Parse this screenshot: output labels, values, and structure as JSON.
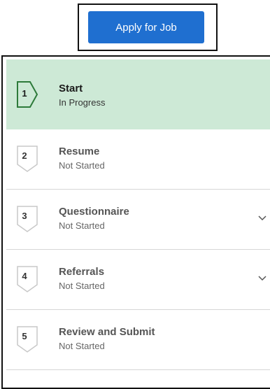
{
  "apply_button": {
    "label": "Apply for Job"
  },
  "colors": {
    "accent": "#1f6fd0",
    "active_step_bg": "#cde9d6",
    "active_step_marker": "#2d7a3a",
    "inactive_marker": "#c8c8c8"
  },
  "steps": [
    {
      "number": "1",
      "title": "Start",
      "status": "In Progress",
      "active": true,
      "expandable": false
    },
    {
      "number": "2",
      "title": "Resume",
      "status": "Not Started",
      "active": false,
      "expandable": false
    },
    {
      "number": "3",
      "title": "Questionnaire",
      "status": "Not Started",
      "active": false,
      "expandable": true
    },
    {
      "number": "4",
      "title": "Referrals",
      "status": "Not Started",
      "active": false,
      "expandable": true
    },
    {
      "number": "5",
      "title": "Review and Submit",
      "status": "Not Started",
      "active": false,
      "expandable": false
    }
  ],
  "icons": {
    "step_marker": "chevron-tag-icon",
    "expand": "chevron-down-icon"
  }
}
